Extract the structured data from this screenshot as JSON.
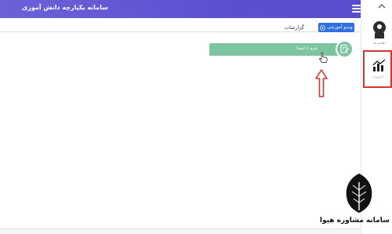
{
  "header": {
    "title": "سامانه یکپارچه دانش آموزی",
    "subtitle": "",
    "menu_icon": "hamburger-icon",
    "color": "#5b4fd0"
  },
  "toolbar": {
    "active_tab": "گزارشات",
    "video_button": "ویدیو آموزشی"
  },
  "menu": {
    "items": [
      {
        "label": "فرم ۶ امضا",
        "icon": "document-edit-icon",
        "color": "#7cc5a0"
      }
    ]
  },
  "sidebar": {
    "items": [
      {
        "label": "اطلاعیه ها",
        "icon": "user-icon"
      },
      {
        "label": "گزارشات",
        "icon": "chart-icon",
        "highlighted": true
      }
    ]
  },
  "watermark": {
    "text": "سامانه مشاوره هیوا",
    "icon": "feather-pen-icon"
  }
}
